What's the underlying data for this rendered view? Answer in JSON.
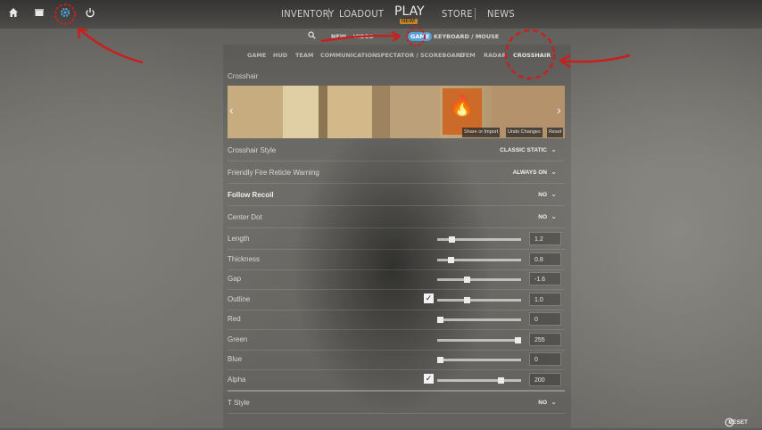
{
  "topbar": {
    "icons": [
      "home-icon",
      "box-icon",
      "gear-icon",
      "power-icon"
    ],
    "nav": {
      "inventory": "INVENTORY",
      "loadout": "LOADOUT",
      "play": "PLAY",
      "play_badge": "NEW!",
      "store": "STORE",
      "news": "NEWS"
    }
  },
  "subnav": {
    "search_icon": "search-icon",
    "items": [
      "NEW",
      "VIDEO",
      "GAME",
      "KEYBOARD / MOUSE"
    ],
    "active": "GAME"
  },
  "categories": [
    "GAME",
    "HUD",
    "TEAM",
    "COMMUNICATION",
    "SPECTATOR / SCOREBOARD",
    "ITEM",
    "RADAR",
    "CROSSHAIR"
  ],
  "active_category": "CROSSHAIR",
  "section_title": "Crosshair",
  "preview": {
    "buttons": [
      "Share or Import",
      "Undo Changes",
      "Reset"
    ]
  },
  "settings": {
    "crosshair_style": {
      "label": "Crosshair Style",
      "value": "CLASSIC STATIC"
    },
    "friendly_fire": {
      "label": "Friendly Fire Reticle Warning",
      "value": "ALWAYS ON"
    },
    "follow_recoil": {
      "label": "Follow Recoil",
      "value": "NO"
    },
    "center_dot": {
      "label": "Center Dot",
      "value": "NO"
    },
    "length": {
      "label": "Length",
      "value": "1.2",
      "level": 0.15
    },
    "thickness": {
      "label": "Thickness",
      "value": "0.8",
      "level": 0.14
    },
    "gap": {
      "label": "Gap",
      "value": "-1.6",
      "level": 0.35
    },
    "outline": {
      "label": "Outline",
      "value": "1.0",
      "level": 0.35,
      "checked": true
    },
    "red": {
      "label": "Red",
      "value": "0",
      "level": 0.0
    },
    "green": {
      "label": "Green",
      "value": "255",
      "level": 1.0
    },
    "blue": {
      "label": "Blue",
      "value": "0",
      "level": 0.0
    },
    "alpha": {
      "label": "Alpha",
      "value": "200",
      "level": 0.78,
      "checked": true
    },
    "t_style": {
      "label": "T Style",
      "value": "NO"
    }
  },
  "footer": {
    "reset": "RESET",
    "reset_icon": "history-icon"
  },
  "colors": {
    "annotation": "#c8201e",
    "badge": "#c8862b",
    "game_pill": "#5aa0d8"
  }
}
